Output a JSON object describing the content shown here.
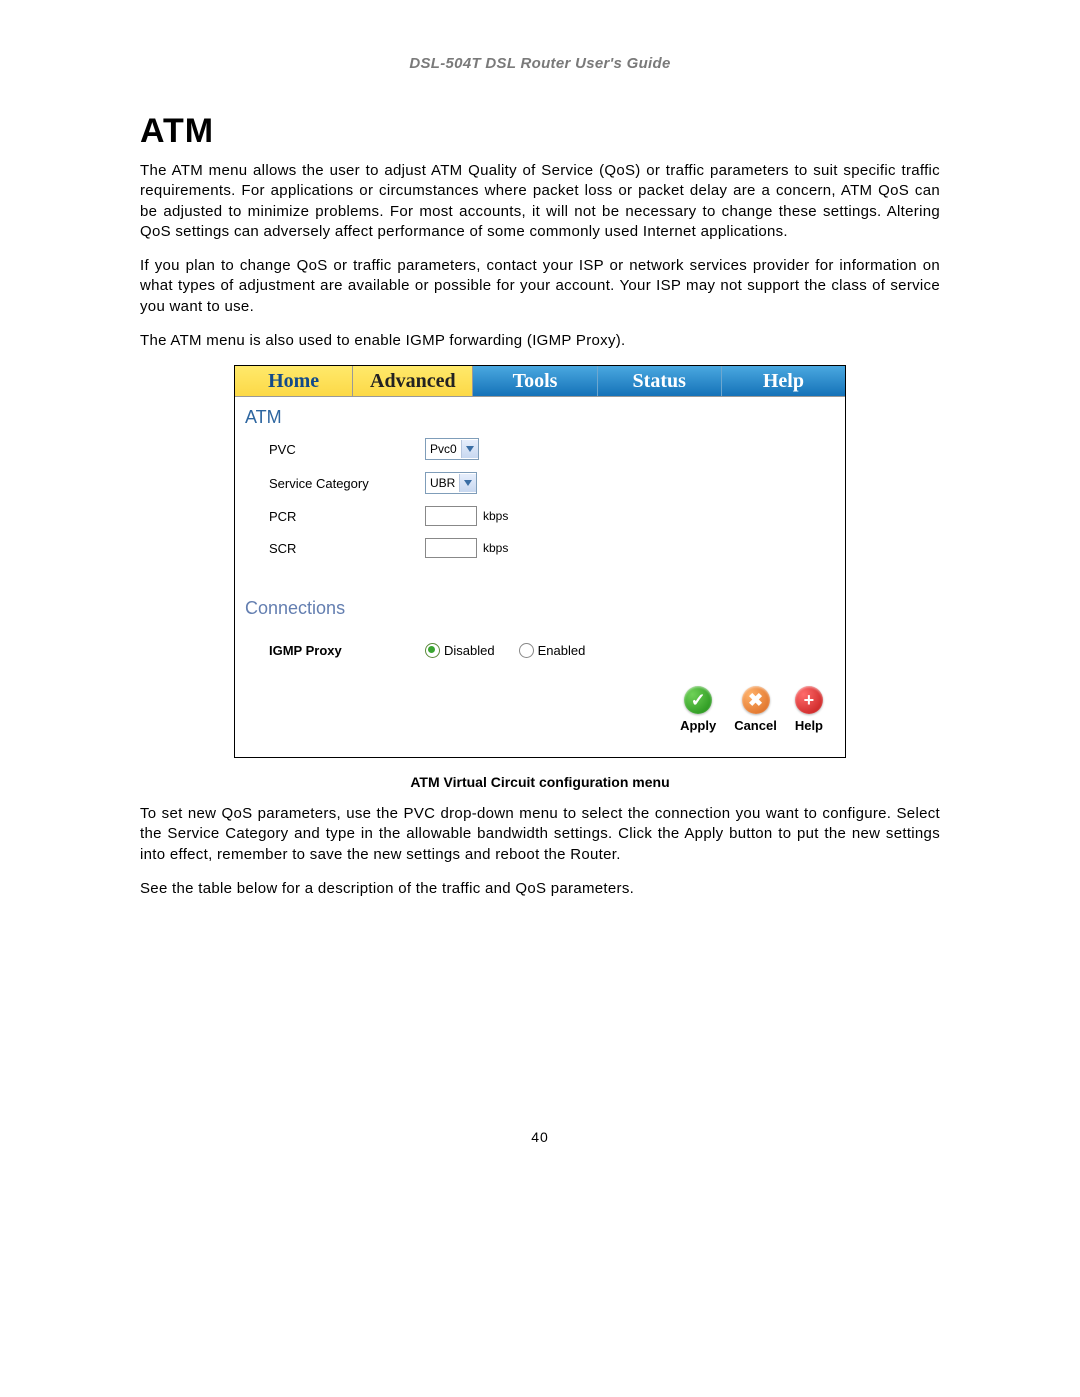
{
  "doc": {
    "header": "DSL-504T DSL Router User's Guide",
    "title": "ATM",
    "para1": "The ATM menu allows the user to adjust ATM Quality of Service (QoS) or traffic parameters to suit specific traffic requirements. For applications or circumstances where packet loss or packet delay are a concern, ATM QoS can be adjusted to minimize problems. For most accounts, it will not be necessary to change these settings. Altering QoS settings can adversely affect performance of some commonly used Internet applications.",
    "para2": "If you plan to change QoS or traffic parameters, contact your ISP or network services provider for information on what types of adjustment are available or possible for your account. Your ISP may not support the class of service you want to use.",
    "para3": "The ATM menu is also used to enable IGMP forwarding (IGMP Proxy).",
    "caption": "ATM Virtual Circuit configuration menu",
    "para4": "To set new QoS parameters, use the PVC drop-down menu to select the connection you want to configure. Select the Service Category and type in the allowable bandwidth settings. Click the Apply button to put the new settings into effect, remember to save the new settings and reboot the Router.",
    "para5": "See the table below for a description of the traffic and QoS parameters.",
    "page_number": "40"
  },
  "ui": {
    "tabs": {
      "home": "Home",
      "advanced": "Advanced",
      "tools": "Tools",
      "status": "Status",
      "help": "Help"
    },
    "section_atm": "ATM",
    "section_connections": "Connections",
    "labels": {
      "pvc": "PVC",
      "service_category": "Service Category",
      "pcr": "PCR",
      "scr": "SCR",
      "igmp_proxy": "IGMP Proxy",
      "kbps": "kbps"
    },
    "selects": {
      "pvc_value": "Pvc0",
      "service_value": "UBR"
    },
    "radios": {
      "disabled": "Disabled",
      "enabled": "Enabled"
    },
    "buttons": {
      "apply": "Apply",
      "cancel": "Cancel",
      "help": "Help"
    }
  }
}
